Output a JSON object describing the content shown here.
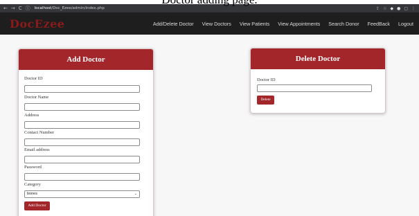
{
  "caption": "Doctor adding page.",
  "browser": {
    "url_host": "localhost",
    "url_path": "/Doc_Ezee/admin/index.php"
  },
  "app": {
    "logo": "DocEzee",
    "nav": [
      "Add/Delete Doctor",
      "View Doctors",
      "View Patients",
      "View Appointments",
      "Search Donor",
      "FeedBack",
      "Logout"
    ]
  },
  "add_doctor": {
    "title": "Add Doctor",
    "labels": {
      "doctor_id": "Doctor ID",
      "doctor_name": "Doctor Name",
      "address": "Address",
      "contact": "Contact Number",
      "email": "Email address",
      "password": "Password",
      "category": "Category"
    },
    "category_value": "bones",
    "submit": "Add Doctor"
  },
  "delete_doctor": {
    "title": "Delete Doctor",
    "label": "Doctor ID",
    "submit": "Delete"
  },
  "colors": {
    "accent": "#a3262b",
    "navbar": "#1e1e1e",
    "logo": "#8b1a1a"
  }
}
